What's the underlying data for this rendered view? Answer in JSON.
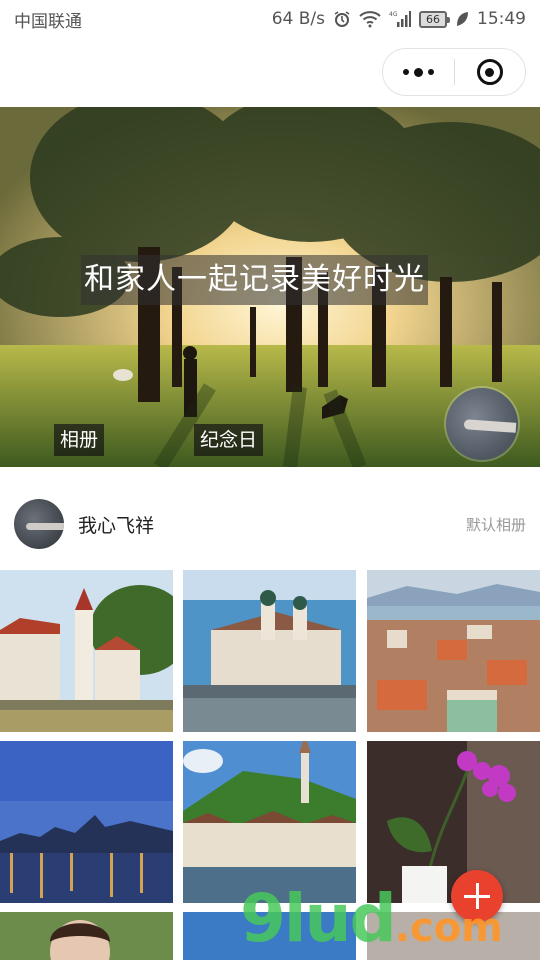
{
  "status_bar": {
    "carrier": "中国联通",
    "speed": "64 B/s",
    "battery": "66",
    "time": "15:49",
    "icons": [
      "alarm-icon",
      "wifi-icon",
      "signal-icon",
      "battery-icon",
      "leaf-icon"
    ]
  },
  "capsule": {
    "more_icon": "more-dots-icon",
    "close_icon": "target-close-icon"
  },
  "banner": {
    "title": "和家人一起记录美好时光",
    "album_label": "相册",
    "memorial_label": "纪念日"
  },
  "user": {
    "name": "我心飞祥",
    "album_link": "默认相册"
  },
  "photos": [
    {
      "subject": "lakeside town with clock tower"
    },
    {
      "subject": "baroque church by water"
    },
    {
      "subject": "city rooftops and lake"
    },
    {
      "subject": "city skyline at night on river"
    },
    {
      "subject": "hillside castle and old town"
    },
    {
      "subject": "pink orchid in white pot"
    },
    {
      "subject": "portrait of woman"
    },
    {
      "subject": "blue sky"
    },
    {
      "subject": "interior"
    }
  ],
  "fab_icon": "plus-icon",
  "watermark": {
    "main": "9lud",
    "suffix": ".com"
  },
  "colors": {
    "accent": "#e8412d",
    "watermark_green": "#46c85a",
    "watermark_orange": "#ff9628"
  }
}
